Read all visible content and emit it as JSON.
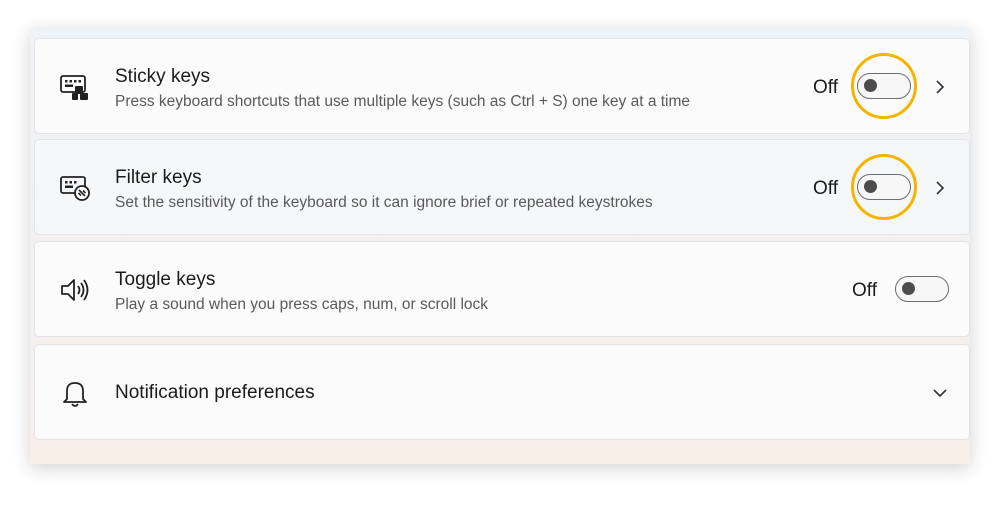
{
  "settings": [
    {
      "title": "Sticky keys",
      "description": "Press keyboard shortcuts that use multiple keys (such as Ctrl + S) one key at a time",
      "state": "Off",
      "icon": "sticky-keys-keyboard-icon",
      "highlighted": true
    },
    {
      "title": "Filter keys",
      "description": "Set the sensitivity of the keyboard so it can ignore brief or repeated keystrokes",
      "state": "Off",
      "icon": "filter-keys-keyboard-icon",
      "highlighted": true
    },
    {
      "title": "Toggle keys",
      "description": "Play a sound when you press caps, num, or scroll lock",
      "state": "Off",
      "icon": "speaker-sound-icon",
      "highlighted": false
    },
    {
      "title": "Notification preferences",
      "icon": "bell-icon"
    }
  ],
  "colors": {
    "highlight_ring": "#f5b400",
    "toggle_knob": "#4d4d4d",
    "card_background": "#fbfbfc"
  }
}
